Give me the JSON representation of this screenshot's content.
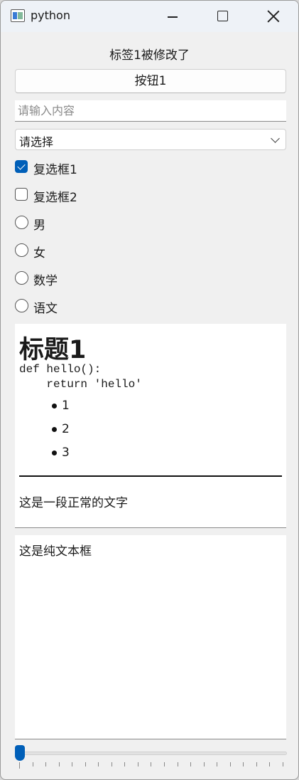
{
  "window": {
    "title": "python"
  },
  "label1": "标签1被修改了",
  "button1": "按钮1",
  "line_edit": {
    "value": "",
    "placeholder": "请输入内容"
  },
  "combo": {
    "selected": "请选择"
  },
  "checkboxes": [
    {
      "label": "复选框1",
      "checked": true
    },
    {
      "label": "复选框2",
      "checked": false
    }
  ],
  "radios": [
    {
      "label": "男",
      "checked": false
    },
    {
      "label": "女",
      "checked": false
    },
    {
      "label": "数学",
      "checked": false
    },
    {
      "label": "语文",
      "checked": false
    }
  ],
  "richtext": {
    "heading": "标题1",
    "code_line1": "def hello():",
    "code_line2": "    return 'hello'",
    "list": [
      "1",
      "2",
      "3"
    ],
    "paragraph": "这是一段正常的文字"
  },
  "plaintext": "这是纯文本框",
  "slider": {
    "value": 0,
    "accent": "#005fb8"
  }
}
